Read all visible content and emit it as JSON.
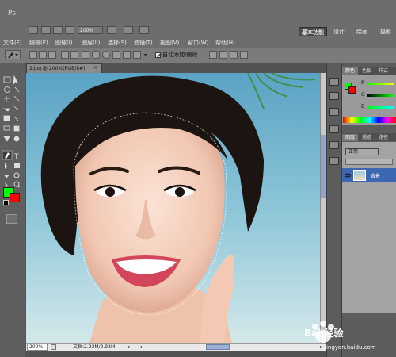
{
  "app": {
    "logo": "Ps"
  },
  "toolbar": {
    "zoom": "200%"
  },
  "workspaces": [
    {
      "label": "基本功能"
    },
    {
      "label": "设计"
    },
    {
      "label": "绘画"
    },
    {
      "label": "摄影"
    }
  ],
  "menu": [
    {
      "label": "文件(F)"
    },
    {
      "label": "编辑(E)"
    },
    {
      "label": "图像(I)"
    },
    {
      "label": "图层(L)"
    },
    {
      "label": "选择(S)"
    },
    {
      "label": "滤镜(T)"
    },
    {
      "label": "视图(V)"
    },
    {
      "label": "窗口(W)"
    },
    {
      "label": "帮助(H)"
    }
  ],
  "options": {
    "auto_add_delete": "自动添加/删除",
    "auto_add_checked": true
  },
  "document": {
    "tab_title": "2.jpg @ 200%(RGB/8#)",
    "close_glyph": "×",
    "zoom": "200%",
    "info": "文档:2.93M/2.93M"
  },
  "colors": {
    "foreground": "#00ff00",
    "background": "#ff0000",
    "accent": "#3d66b3"
  },
  "panels": {
    "color_tabs": [
      {
        "label": "颜色"
      },
      {
        "label": "色板"
      },
      {
        "label": "样式"
      }
    ],
    "channels": [
      {
        "label": "R"
      },
      {
        "label": "G"
      },
      {
        "label": "B"
      }
    ],
    "layer_tabs": [
      {
        "label": "图层"
      },
      {
        "label": "通道"
      },
      {
        "label": "路径"
      }
    ],
    "blend_mode": "正常",
    "layer_name": "背景"
  },
  "watermark": {
    "text": "Bai 经验",
    "sub": "jingyan.baidu.com"
  }
}
